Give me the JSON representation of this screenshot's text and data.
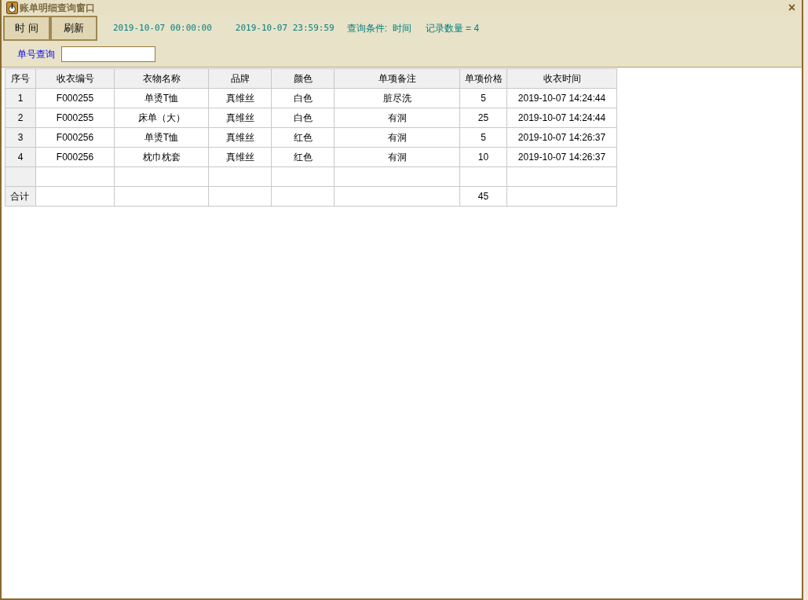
{
  "window": {
    "title": "账单明细查询窗口",
    "close": "×"
  },
  "toolbar": {
    "buttons": [
      "时 间",
      "刷新"
    ],
    "start_time": "2019-10-07 00:00:00",
    "end_time": "2019-10-07 23:59:59",
    "condition": "查询条件:  时间",
    "record_count": "记录数量 = 4"
  },
  "search": {
    "label": "单号查询"
  },
  "table": {
    "columns": [
      "序号",
      "收衣编号",
      "衣物名称",
      "品牌",
      "颜色",
      "单项备注",
      "单项价格",
      "收衣时间"
    ],
    "rows": [
      {
        "kind": "item",
        "cells": [
          "1",
          "F000255",
          "单烫T恤",
          "真维丝",
          "白色",
          "脏尽洗",
          "5",
          "2019-10-07 14:24:44"
        ]
      },
      {
        "kind": "item",
        "cells": [
          "2",
          "F000255",
          "床单（大）",
          "真维丝",
          "白色",
          "有洞",
          "25",
          "2019-10-07 14:24:44"
        ]
      },
      {
        "kind": "item",
        "cells": [
          "3",
          "F000256",
          "单烫T恤",
          "真维丝",
          "红色",
          "有洞",
          "5",
          "2019-10-07 14:26:37"
        ]
      },
      {
        "kind": "item",
        "cells": [
          "4",
          "F000256",
          "枕巾枕套",
          "真维丝",
          "红色",
          "有洞",
          "10",
          "2019-10-07 14:26:37"
        ]
      },
      {
        "kind": "blank"
      },
      {
        "kind": "total",
        "label": "合计",
        "unit_price": "45"
      }
    ]
  }
}
